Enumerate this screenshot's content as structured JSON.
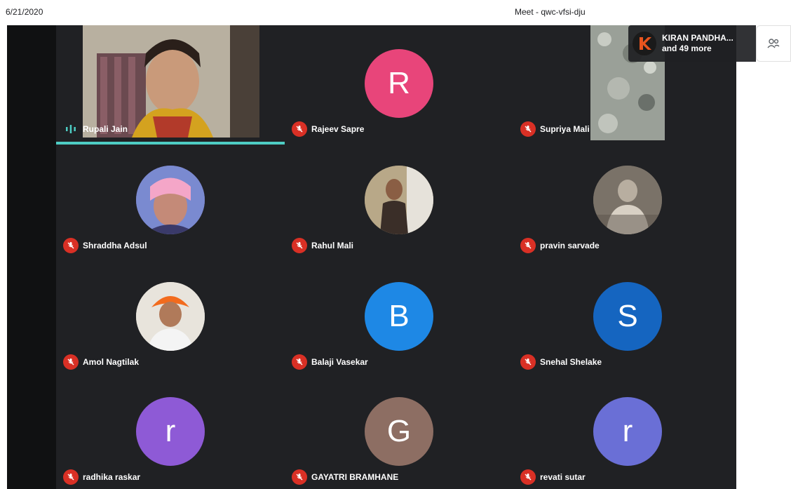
{
  "print_header": {
    "date": "6/21/2020",
    "meeting_title": "Meet - qwc-vfsi-dju"
  },
  "notification": {
    "name": "KIRAN PANDHA...",
    "more": "and 49 more"
  },
  "colors": {
    "stage_bg": "#202124",
    "speaking_accent": "#4ecdc4",
    "mic_off": "#d93025"
  },
  "participants": [
    {
      "name": "Rupali Jain",
      "kind": "video",
      "mic": "on",
      "speaking": true
    },
    {
      "name": "Rajeev Sapre",
      "kind": "initial",
      "initial": "R",
      "color": "#e8457a",
      "mic": "off"
    },
    {
      "name": "Supriya Mali",
      "kind": "video",
      "mic": "off"
    },
    {
      "name": "Shraddha Adsul",
      "kind": "photo",
      "mic": "off"
    },
    {
      "name": "Rahul Mali",
      "kind": "photo",
      "mic": "off"
    },
    {
      "name": "pravin sarvade",
      "kind": "photo",
      "mic": "off"
    },
    {
      "name": "Amol Nagtilak",
      "kind": "photo",
      "mic": "off"
    },
    {
      "name": "Balaji Vasekar",
      "kind": "initial",
      "initial": "B",
      "color": "#1e88e5",
      "mic": "off"
    },
    {
      "name": "Snehal Shelake",
      "kind": "initial",
      "initial": "S",
      "color": "#1565c0",
      "mic": "off"
    },
    {
      "name": "radhika raskar",
      "kind": "initial",
      "initial": "r",
      "color": "#8e5ad6",
      "mic": "off"
    },
    {
      "name": "GAYATRI BRAMHANE",
      "kind": "initial",
      "initial": "G",
      "color": "#8d6e63",
      "mic": "off"
    },
    {
      "name": "revati sutar",
      "kind": "initial",
      "initial": "r",
      "color": "#6a6fd6",
      "mic": "off"
    }
  ]
}
